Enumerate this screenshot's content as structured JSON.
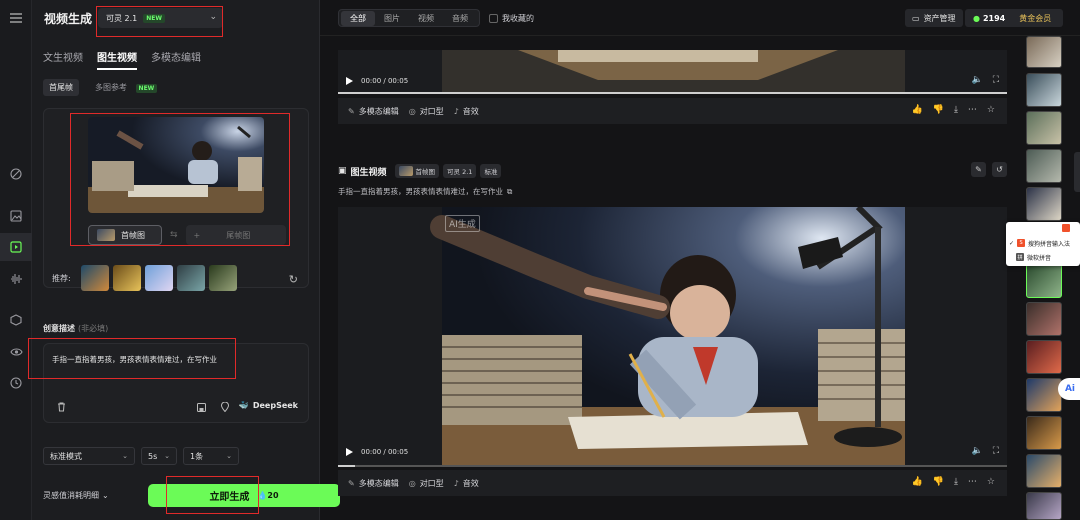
{
  "app": {
    "panel_title": "视频生成"
  },
  "model_select": {
    "value": "可灵 2.1",
    "badge": "NEW"
  },
  "gen_tabs": [
    "文生视频",
    "图生视频",
    "多模态编辑"
  ],
  "sub_tabs": {
    "first_last": "首尾帧",
    "multi_ref": "多图参考",
    "badge": "NEW"
  },
  "frames": {
    "first": "首帧图",
    "last": "尾帧图"
  },
  "recommend_label": "推荐:",
  "description": {
    "label": "创意描述",
    "optional": "(非必填)",
    "text": "手指一直指着男孩，男孩表情表情难过，在写作业",
    "deepseek": "DeepSeek"
  },
  "settings": {
    "mode": "标准模式",
    "duration": "5s",
    "count": "1条"
  },
  "cost_info": "灵感值消耗明细",
  "generate": {
    "label": "立即生成",
    "cost": "20"
  },
  "top_filters": [
    "全部",
    "图片",
    "视频",
    "音频"
  ],
  "favorites_label": "我收藏的",
  "asset_button": "资产管理",
  "points": "2194",
  "membership": "黄金会员",
  "video1": {
    "time": "00:00 / 00:05",
    "progress": 1.0
  },
  "video2": {
    "time": "00:00 / 00:05",
    "progress": 0.025,
    "watermark": "AI生成"
  },
  "actions": {
    "multimodal_edit": "多模态编辑",
    "lip_sync": "对口型",
    "sound_fx": "音效"
  },
  "card2": {
    "title": "图生视频",
    "chip_first": "首帧图",
    "chip_model": "可灵 2.1",
    "chip_mode": "标准",
    "prompt": "手指一直指着男孩，男孩表情表情难过，在写作业"
  },
  "ime_popup": {
    "option1": "搜狗拼音输入法",
    "option2": "微软拼音"
  },
  "ai_fab": "Ai"
}
